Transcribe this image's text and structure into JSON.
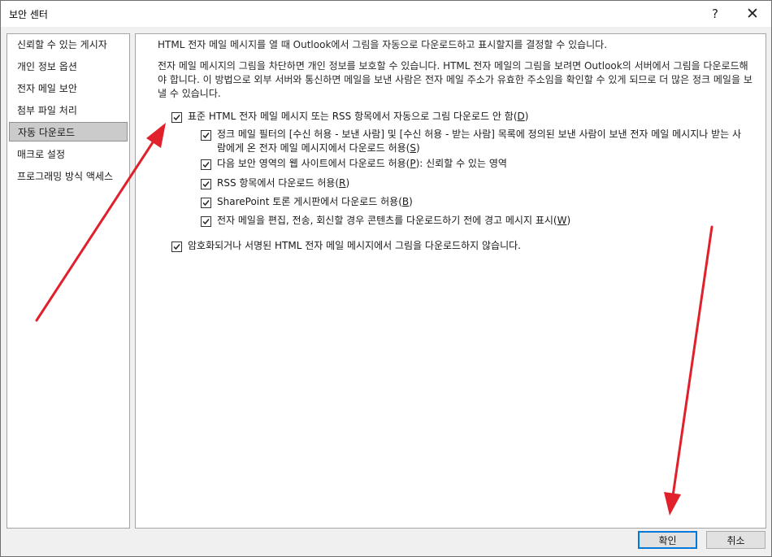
{
  "window": {
    "title": "보안 센터",
    "help_label": "?",
    "close_label": "✕"
  },
  "sidebar": {
    "items": [
      {
        "label": "신뢰할 수 있는 게시자"
      },
      {
        "label": "개인 정보 옵션"
      },
      {
        "label": "전자 메일 보안"
      },
      {
        "label": "첨부 파일 처리"
      },
      {
        "label": "자동 다운로드"
      },
      {
        "label": "매크로 설정"
      },
      {
        "label": "프로그래밍 방식 액세스"
      }
    ],
    "selected": "자동 다운로드"
  },
  "main": {
    "intro": "HTML 전자 메일 메시지를 열 때 Outlook에서 그림을 자동으로 다운로드하고 표시할지를 결정할 수 있습니다.",
    "description": "전자 메일 메시지의 그림을 차단하면 개인 정보를 보호할 수 있습니다. HTML 전자 메일의 그림을 보려면 Outlook의 서버에서 그림을 다운로드해야 합니다. 이 방법으로 외부 서버와 통신하면 메일을 보낸 사람은 전자 메일 주소가 유효한 주소임을 확인할 수 있게 되므로 더 많은 정크 메일을 보낼 수 있습니다.",
    "options": {
      "no_auto_download": {
        "text": "표준 HTML 전자 메일 메시지 또는 RSS 항목에서 자동으로 그림 다운로드 안 함",
        "key": "D",
        "checked": true
      },
      "junk_filter": {
        "text": "정크 메일 필터의 [수신 허용 - 보낸 사람] 및 [수신 허용 - 받는 사람] 목록에 정의된 보낸 사람이 보낸 전자 메일 메시지나 받는 사람에게 온 전자 메일 메시지에서 다운로드 허용",
        "key": "S",
        "checked": true
      },
      "security_zone": {
        "text": "다음 보안 영역의 웹 사이트에서 다운로드 허용",
        "key": "P",
        "suffix": ": 신뢰할 수 있는 영역",
        "checked": true
      },
      "rss": {
        "text": "RSS 항목에서 다운로드 허용",
        "key": "R",
        "checked": true
      },
      "sharepoint": {
        "text": "SharePoint 토론 게시판에서 다운로드 허용",
        "key": "B",
        "checked": true
      },
      "warn_before": {
        "text": "전자 메일을 편집, 전송, 회신할 경우 콘텐츠를 다운로드하기 전에 경고 메시지 표시",
        "key": "W",
        "checked": true
      },
      "encrypted": {
        "text": "암호화되거나 서명된 HTML 전자 메일 메시지에서 그림을 다운로드하지 않습니다.",
        "checked": true
      }
    }
  },
  "footer": {
    "ok_label": "확인",
    "cancel_label": "취소"
  },
  "colors": {
    "annotation_arrow": "#e0202a",
    "default_button_border": "#0078d7",
    "selected_nav_bg": "#cbcbcb"
  }
}
